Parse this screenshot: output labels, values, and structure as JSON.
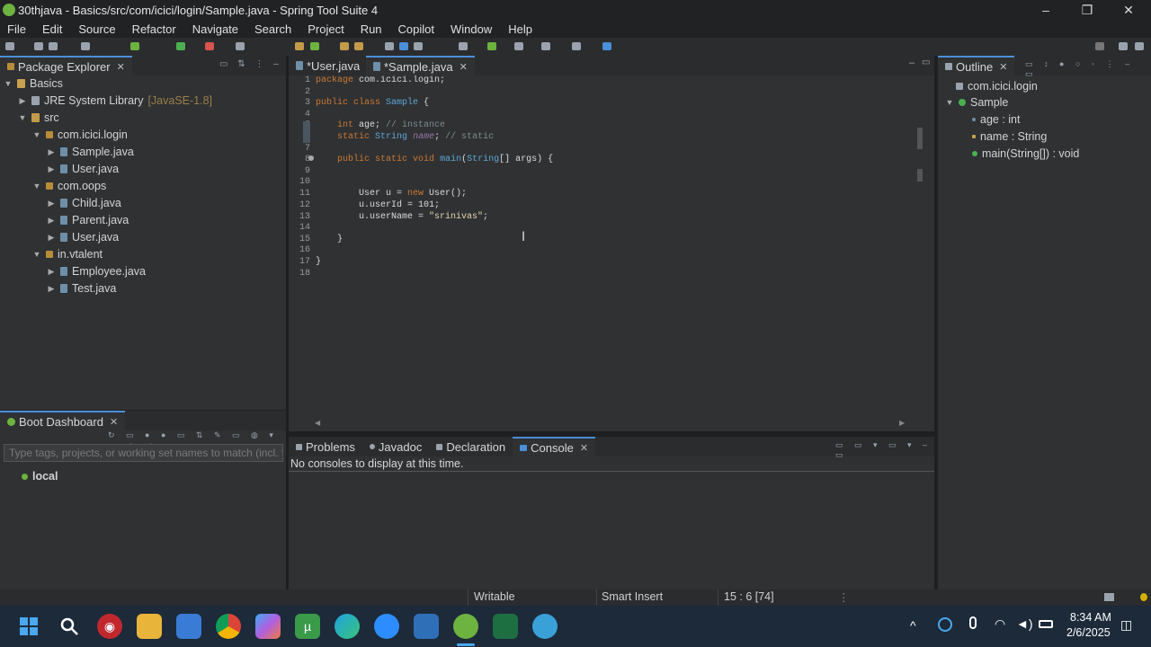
{
  "window": {
    "title": "30thjava - Basics/src/com/icici/login/Sample.java - Spring Tool Suite 4"
  },
  "menu": [
    "File",
    "Edit",
    "Source",
    "Refactor",
    "Navigate",
    "Search",
    "Project",
    "Run",
    "Copilot",
    "Window",
    "Help"
  ],
  "package_explorer": {
    "tab": "Package Explorer",
    "items": [
      {
        "label": "Basics",
        "type": "proj"
      },
      {
        "label": "JRE System Library",
        "suffix": "[JavaSE-1.8]",
        "type": "lib"
      },
      {
        "label": "src",
        "type": "src"
      },
      {
        "label": "com.icici.login",
        "type": "pkg"
      },
      {
        "label": "Sample.java",
        "type": "java"
      },
      {
        "label": "User.java",
        "type": "java"
      },
      {
        "label": "com.oops",
        "type": "pkg"
      },
      {
        "label": "Child.java",
        "type": "java"
      },
      {
        "label": "Parent.java",
        "type": "java"
      },
      {
        "label": "User.java",
        "type": "java"
      },
      {
        "label": "in.vtalent",
        "type": "pkg"
      },
      {
        "label": "Employee.java",
        "type": "java"
      },
      {
        "label": "Test.java",
        "type": "java"
      }
    ]
  },
  "editor": {
    "tabs": [
      "*User.java",
      "*Sample.java"
    ],
    "line_numbers": [
      "1",
      "2",
      "3",
      "4",
      "5",
      "6",
      "7",
      "8",
      "9",
      "10",
      "11",
      "12",
      "13",
      "14",
      "15",
      "16",
      "17",
      "18"
    ]
  },
  "outline": {
    "tab": "Outline",
    "items": [
      "com.icici.login",
      "Sample",
      "age : int",
      "name : String",
      "main(String[]) : void"
    ]
  },
  "boot_dashboard": {
    "tab": "Boot Dashboard",
    "filter_placeholder": "Type tags, projects, or working set names to match (incl. * and ? wildcards)",
    "local": "local"
  },
  "console_area": {
    "tabs": [
      "Problems",
      "Javadoc",
      "Declaration",
      "Console"
    ],
    "message": "No consoles to display at this time."
  },
  "status": {
    "writable": "Writable",
    "insert": "Smart Insert",
    "position": "15 : 6 [74]"
  },
  "taskbar": {
    "time": "8:34 AM",
    "date": "2/6/2025"
  },
  "colors": {
    "selection": "#2456b0",
    "accent": "#4a8fd8"
  }
}
